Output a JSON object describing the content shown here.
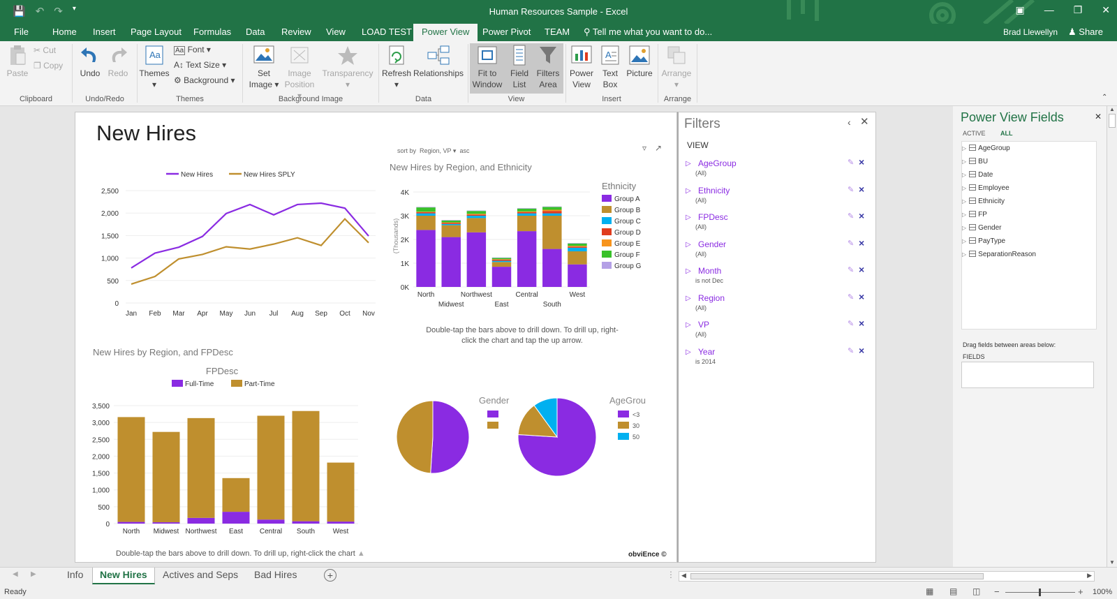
{
  "window": {
    "title": "Human Resources Sample - Excel"
  },
  "tabs": [
    "File",
    "Home",
    "Insert",
    "Page Layout",
    "Formulas",
    "Data",
    "Review",
    "View",
    "LOAD TEST",
    "Power View",
    "Power Pivot",
    "TEAM"
  ],
  "active_tab": "Power View",
  "tell_me": "Tell me what you want to do...",
  "user": "Brad Llewellyn",
  "share": "Share",
  "ribbon": {
    "clipboard": {
      "paste": "Paste",
      "cut": "Cut",
      "copy": "Copy",
      "label": "Clipboard"
    },
    "undoredo": {
      "undo": "Undo",
      "redo": "Redo",
      "label": "Undo/Redo"
    },
    "themes": {
      "themes": "Themes",
      "font": "Font",
      "text_size": "Text Size",
      "background": "Background",
      "label": "Themes"
    },
    "bgimage": {
      "set_image_1": "Set",
      "set_image_2": "Image",
      "image_position_1": "Image",
      "image_position_2": "Position",
      "transparency": "Transparency",
      "label": "Background Image"
    },
    "data": {
      "refresh": "Refresh",
      "relationships": "Relationships",
      "label": "Data"
    },
    "view": {
      "fit_1": "Fit to",
      "fit_2": "Window",
      "field_1": "Field",
      "field_2": "List",
      "filters_1": "Filters",
      "filters_2": "Area",
      "label": "View"
    },
    "insert": {
      "pv_1": "Power",
      "pv_2": "View",
      "tb_1": "Text",
      "tb_2": "Box",
      "picture": "Picture",
      "label": "Insert"
    },
    "arrange": {
      "arrange": "Arrange",
      "label": "Arrange"
    }
  },
  "report": {
    "title": "New Hires",
    "sort": {
      "prefix": "sort by",
      "field": "Region, VP",
      "dir": "asc"
    },
    "drill_hint_1": "Double-tap the bars above to drill down. To drill up, right-",
    "drill_hint_2": "click the chart and tap the up arrow.",
    "drill_hint_bottom": "Double-tap the bars above to drill down. To drill up, right-click the chart",
    "watermark": "obviEnce ©"
  },
  "chart_data": [
    {
      "type": "line",
      "x": [
        "Jan",
        "Feb",
        "Mar",
        "Apr",
        "May",
        "Jun",
        "Jul",
        "Aug",
        "Sep",
        "Oct",
        "Nov"
      ],
      "series": [
        {
          "name": "New Hires",
          "values": [
            780,
            1110,
            1240,
            1480,
            1990,
            2190,
            1960,
            2190,
            2220,
            2110,
            1490
          ]
        },
        {
          "name": "New Hires SPLY",
          "values": [
            420,
            590,
            980,
            1080,
            1250,
            1200,
            1310,
            1450,
            1280,
            1870,
            1340
          ]
        }
      ],
      "ylim": [
        0,
        2500
      ],
      "yticks": [
        "0",
        "500",
        "1,000",
        "1,500",
        "2,000",
        "2,500"
      ],
      "colors": [
        "#8a2be2",
        "#bf8f2e"
      ]
    },
    {
      "type": "bar",
      "title": "New Hires by Region, and Ethnicity",
      "ylabel": "(Thousands)",
      "legend_title": "Ethnicity",
      "categories": [
        "North",
        "Midwest",
        "Northwest",
        "East",
        "Central",
        "South",
        "West"
      ],
      "series": [
        {
          "name": "Group A",
          "values": [
            2.4,
            2.1,
            2.3,
            0.85,
            2.35,
            1.6,
            0.95
          ]
        },
        {
          "name": "Group B",
          "values": [
            0.6,
            0.5,
            0.6,
            0.2,
            0.65,
            1.4,
            0.55
          ]
        },
        {
          "name": "Group C",
          "values": [
            0.1,
            0.05,
            0.1,
            0.05,
            0.1,
            0.1,
            0.15
          ]
        },
        {
          "name": "Group D",
          "values": [
            0.05,
            0.05,
            0.05,
            0.05,
            0.05,
            0.1,
            0.05
          ]
        },
        {
          "name": "Group E",
          "values": [
            0.02,
            0.02,
            0.03,
            0.02,
            0.03,
            0.05,
            0.03
          ]
        },
        {
          "name": "Group F",
          "values": [
            0.18,
            0.08,
            0.12,
            0.05,
            0.12,
            0.12,
            0.1
          ]
        },
        {
          "name": "Group G",
          "values": [
            0.02,
            0.02,
            0.02,
            0.02,
            0.02,
            0.02,
            0.02
          ]
        }
      ],
      "ylim": [
        0,
        4
      ],
      "yticks": [
        "0K",
        "1K",
        "2K",
        "3K",
        "4K"
      ],
      "colors": [
        "#8a2be2",
        "#bf8f2e",
        "#00b0f0",
        "#e03c1e",
        "#f7941d",
        "#39c12a",
        "#b4a0e6"
      ]
    },
    {
      "type": "bar",
      "title": "New Hires by Region, and FPDesc",
      "legend_title": "FPDesc",
      "categories": [
        "North",
        "Midwest",
        "Northwest",
        "East",
        "Central",
        "South",
        "West"
      ],
      "series": [
        {
          "name": "Full-Time",
          "values": [
            50,
            40,
            170,
            350,
            120,
            70,
            60
          ]
        },
        {
          "name": "Part-Time",
          "values": [
            3110,
            2680,
            2960,
            1000,
            3080,
            3270,
            1750
          ]
        }
      ],
      "ylim": [
        0,
        3500
      ],
      "yticks": [
        "0",
        "500",
        "1,000",
        "1,500",
        "2,000",
        "2,500",
        "3,000",
        "3,500"
      ],
      "colors": [
        "#8a2be2",
        "#bf8f2e"
      ]
    },
    {
      "type": "pie",
      "title": "Gender",
      "slices": [
        {
          "value": 51
        },
        {
          "value": 49
        }
      ],
      "colors": [
        "#8a2be2",
        "#bf8f2e"
      ]
    },
    {
      "type": "pie",
      "title": "AgeGrou",
      "legend_labels": [
        "<3",
        "30",
        "50"
      ],
      "slices": [
        {
          "value": 76
        },
        {
          "value": 14
        },
        {
          "value": 10
        }
      ],
      "colors": [
        "#8a2be2",
        "#bf8f2e",
        "#00b0f0"
      ]
    }
  ],
  "filters": {
    "title": "Filters",
    "section": "VIEW",
    "items": [
      {
        "name": "AgeGroup",
        "value": "(All)"
      },
      {
        "name": "Ethnicity",
        "value": "(All)"
      },
      {
        "name": "FPDesc",
        "value": "(All)"
      },
      {
        "name": "Gender",
        "value": "(All)"
      },
      {
        "name": "Month",
        "value": "is not Dec"
      },
      {
        "name": "Region",
        "value": "(All)"
      },
      {
        "name": "VP",
        "value": "(All)"
      },
      {
        "name": "Year",
        "value": "is 2014"
      }
    ]
  },
  "fields": {
    "title": "Power View Fields",
    "active": "ACTIVE",
    "all": "ALL",
    "items": [
      "AgeGroup",
      "BU",
      "Date",
      "Employee",
      "Ethnicity",
      "FP",
      "Gender",
      "PayType",
      "SeparationReason"
    ],
    "drag_hint": "Drag fields between areas below:",
    "fields_label": "FIELDS"
  },
  "sheets": [
    "Info",
    "New Hires",
    "Actives and Seps",
    "Bad Hires"
  ],
  "active_sheet": "New Hires",
  "status": {
    "ready": "Ready",
    "zoom": "100%"
  }
}
